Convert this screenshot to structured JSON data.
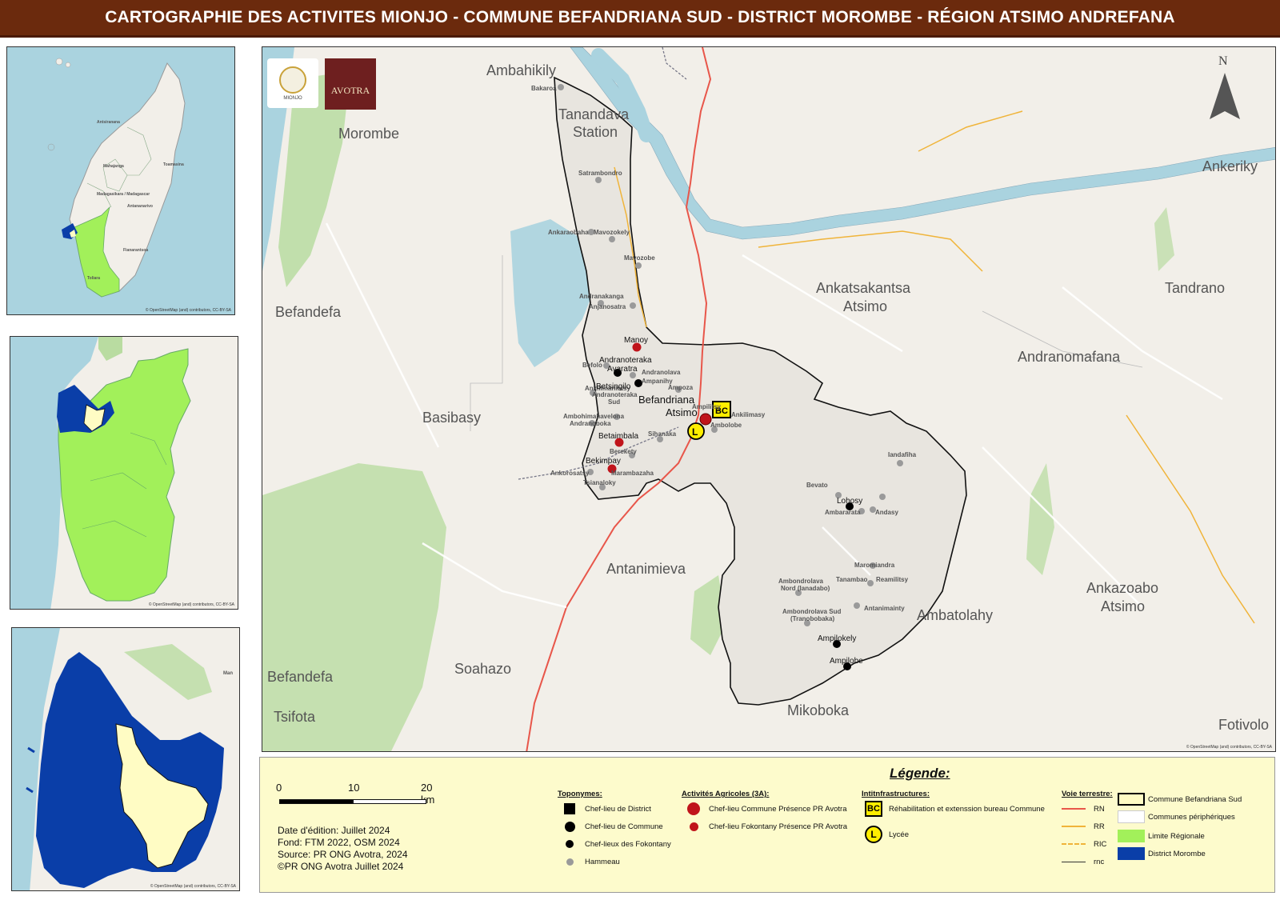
{
  "title": "CARTOGRAPHIE DES ACTIVITES MIONJO -  COMMUNE BEFANDRIANA SUD - DISTRICT MOROMBE - RÉGION ATSIMO ANDREFANA",
  "colors": {
    "title_bar": "#6b2a0d",
    "water": "#aad3df",
    "land": "#f2efe9",
    "forest": "#b9dca1",
    "commune_fill": "#e8e5df",
    "region_green": "#a2f05a",
    "district_blue": "#0a3ea8",
    "commune_yellow": "#fffcc4",
    "legend_bg": "#fdfbcc",
    "road_rn": "#e8564a",
    "road_rr": "#f0b43a",
    "red_marker": "#c0141b",
    "gray_marker": "#9a9a9a"
  },
  "insets": {
    "inset1": {
      "attribution": "© OpenStreetMap (and) contributors, CC-BY-SA",
      "labels": [
        "Mahajanga",
        "Madagasikara / Madagascar",
        "Toamasina",
        "Antananarivo",
        "Fianarantsoa",
        "Toliara",
        "Antsiranana"
      ]
    },
    "inset2": {
      "attribution": "© OpenStreetMap (and) contributors, CC-BY-SA"
    },
    "inset3": {
      "attribution": "© OpenStreetMap (and) contributors, CC-BY-SA",
      "edge_label": "Man"
    }
  },
  "main_map": {
    "attribution": "© OpenStreetMap (and) contributors, CC-BY-SA",
    "north": "N",
    "logos": {
      "mionjo": "MIONJO",
      "avotra": "AVOTRA"
    },
    "region_labels": [
      "Ambahikily",
      "Tanandava",
      "Station",
      "Morombe",
      "Befandefa",
      "Basibasy",
      "Ankatsakantsa",
      "Atsimo",
      "Andranomafana",
      "Tandrano",
      "Ankeriky",
      "Antanimieva",
      "Soahazo",
      "Befandefa",
      "Tsifota",
      "Mikoboka",
      "Ambatolahy",
      "Ankazoabo",
      "Atsimo",
      "Fotivolo"
    ],
    "hamlets": [
      "Bakaroa",
      "Satrambondro",
      "Ankaraobaha",
      "Mavozokely",
      "Mavozobe",
      "Andranakanga",
      "Anjanosatra",
      "Befolo",
      "Andranolava",
      "Ankilimanintsy",
      "Andranoteraka",
      "Sud",
      "Ampanihy",
      "Ampoza",
      "Ambohimahavelona",
      "Andranoboka",
      "Sihanaka",
      "Berekety",
      "Ankorosatsy",
      "Marambazaha",
      "Tsianaloky",
      "Ambolobe",
      "Ankilimasy",
      "Ampilitsy",
      "Iandafiha",
      "Bevato",
      "Ambararata",
      "Andasy",
      "Maromiandra",
      "Tanambao",
      "Reamilitsy",
      "Ambondrolava",
      "Nord (Ianadabo)",
      "Ambondrolava Sud",
      "(Tranobobaka)",
      "Antanimainty"
    ],
    "fokontany": [
      "Andranoteraka",
      "Avaratra",
      "Betsingilo",
      "Lohosy",
      "Ampilokely",
      "Ampilobe"
    ],
    "fokontany_red": [
      "Manoy",
      "Betaimbala",
      "Bekimpay"
    ],
    "commune": [
      "Befandriana",
      "Atsimo"
    ]
  },
  "legend": {
    "title": "Légende:",
    "scale": {
      "labels": [
        "0",
        "10",
        "20 km"
      ]
    },
    "info": [
      "Date d'édition: Juillet 2024",
      "Fond: FTM 2022, OSM 2024",
      "Source: PR ONG Avotra, 2024",
      "©PR ONG Avotra Juillet 2024"
    ],
    "toponymes": {
      "heading": "Toponymes:",
      "items": [
        "Chef-lieu de District",
        "Chef-lieu de Commune",
        "Chef-lieux des Fokontany",
        "Hammeau"
      ]
    },
    "activites": {
      "heading": "Activités Agricoles (3A):",
      "items": [
        "Chef-lieu Commune Présence PR Avotra",
        "Chef-lieu Fokontany Présence PR Avotra"
      ]
    },
    "infrastructures": {
      "heading": "Intitnfrastructures:",
      "bc_symbol": "BC",
      "lycee_symbol": "L",
      "items": [
        "Réhabilitation et extenssion bureau Commune",
        "Lycée"
      ]
    },
    "voie": {
      "heading": "Voie terrestre:",
      "items": [
        "RN",
        "RR",
        "RIC",
        "rnc"
      ]
    },
    "zones": {
      "items": [
        "Commune Befandriana Sud",
        "Communes périphériques",
        "Limite Régionale",
        "District Morombe"
      ]
    }
  }
}
